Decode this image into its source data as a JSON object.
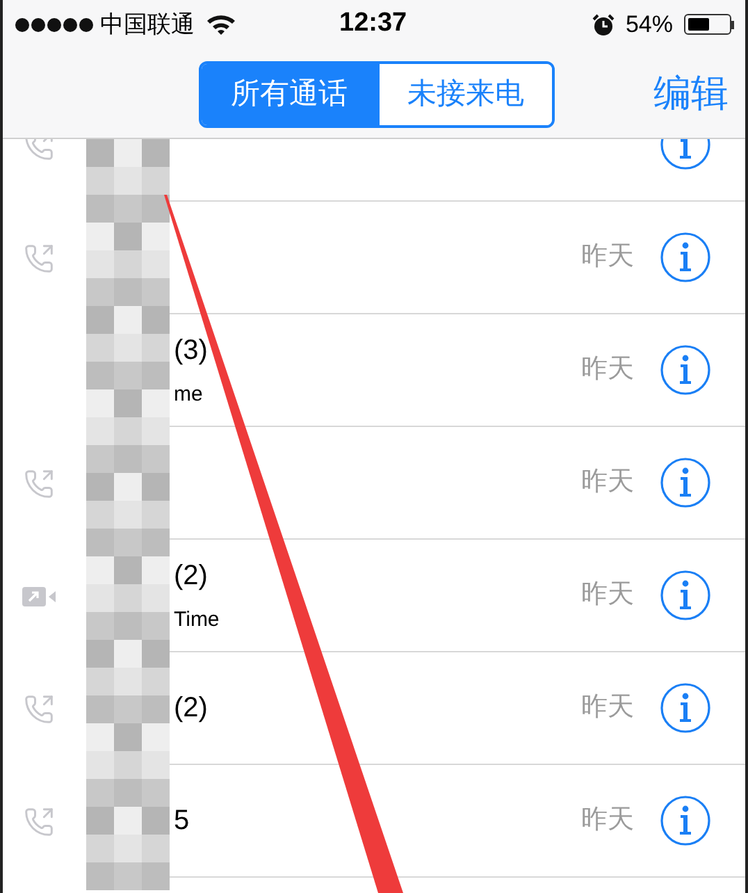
{
  "status_bar": {
    "carrier": "中国联通",
    "time": "12:37",
    "battery_text": "54%",
    "battery": {
      "level": 0.54
    }
  },
  "segments": [
    {
      "label": "所有通话",
      "selected": true
    },
    {
      "label": "未接来电",
      "selected": false
    }
  ],
  "edit_button": "编辑",
  "calls": [
    {
      "kind": "voice"
    },
    {
      "kind": "voice",
      "date": "昨天"
    },
    {
      "kind": "none",
      "name": "(3)",
      "subtitle": "me",
      "date": "昨天"
    },
    {
      "kind": "voice",
      "date": "昨天"
    },
    {
      "kind": "video",
      "name": "(2)",
      "subtitle": "Time",
      "date": "昨天"
    },
    {
      "kind": "voice",
      "name": "(2)",
      "date": "昨天"
    },
    {
      "kind": "voice",
      "name": "5",
      "date": "昨天"
    }
  ]
}
